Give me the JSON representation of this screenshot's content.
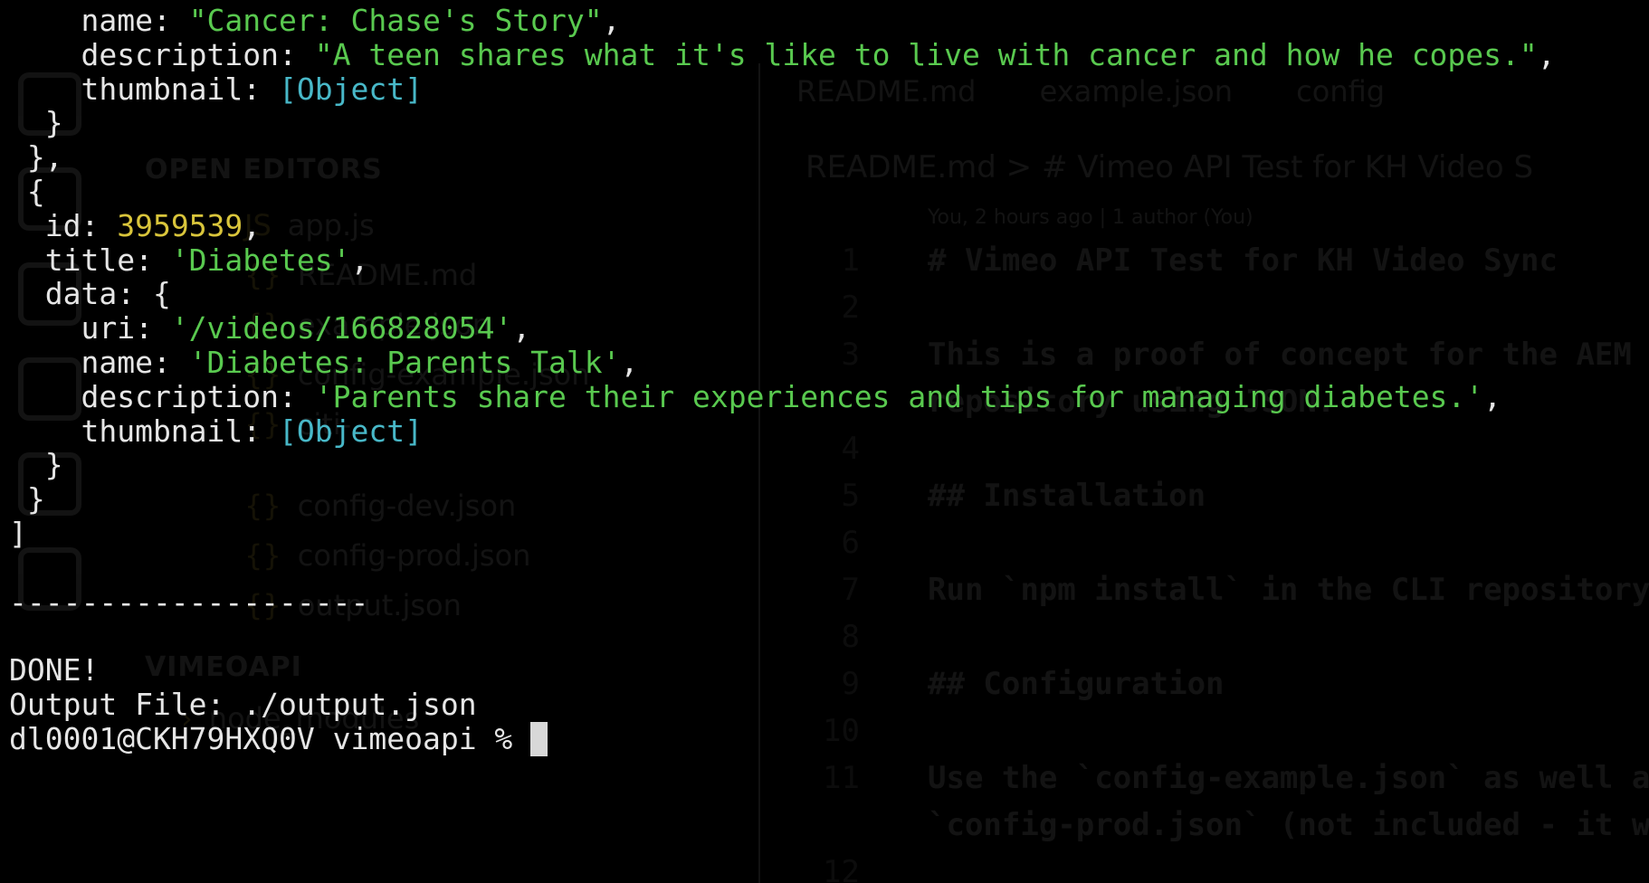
{
  "background_editor": {
    "explorer": {
      "open_editors_header": "OPEN EDITORS",
      "open_editors": [
        "app.js",
        "README.md",
        "example.json",
        "config-example.json",
        "citi-...",
        "config-dev.json",
        "config-prod.json",
        "output.json"
      ],
      "project_header": "VIMEOAPI",
      "project_items": [
        "node_modules"
      ]
    },
    "tabs": [
      "README.md",
      "example.json",
      "config"
    ],
    "breadcrumb": "README.md > # Vimeo API Test for KH Video S",
    "blame": "You, 2 hours ago | 1 author (You)",
    "code_lines": [
      {
        "n": "1",
        "text": "# Vimeo API Test for KH Video Sync"
      },
      {
        "n": "2",
        "text": ""
      },
      {
        "n": "3",
        "text": "This is a proof of concept for the AEM"
      },
      {
        "n": "",
        "text": "repository using JSON."
      },
      {
        "n": "4",
        "text": ""
      },
      {
        "n": "5",
        "text": "## Installation"
      },
      {
        "n": "6",
        "text": ""
      },
      {
        "n": "7",
        "text": "Run `npm install` in the CLI repository"
      },
      {
        "n": "8",
        "text": ""
      },
      {
        "n": "9",
        "text": "## Configuration"
      },
      {
        "n": "10",
        "text": ""
      },
      {
        "n": "11",
        "text": "Use the `config-example.json` as well a"
      },
      {
        "n": "",
        "text": "`config-prod.json` (not included - it w"
      },
      {
        "n": "12",
        "text": ""
      }
    ]
  },
  "terminal": {
    "lines": [
      [
        {
          "t": "    name: "
        },
        {
          "t": "\"Cancer: Chase's Story\"",
          "c": "str"
        },
        {
          "t": ","
        }
      ],
      [
        {
          "t": "    description: "
        },
        {
          "t": "\"A teen shares what it's like to live with cancer and how he copes.\"",
          "c": "str"
        },
        {
          "t": ","
        }
      ],
      [
        {
          "t": "    thumbnail: "
        },
        {
          "t": "[Object]",
          "c": "obj"
        }
      ],
      [
        {
          "t": "  }"
        }
      ],
      [
        {
          "t": " },"
        }
      ],
      [
        {
          "t": " {"
        }
      ],
      [
        {
          "t": "  id: "
        },
        {
          "t": "3959539",
          "c": "num"
        },
        {
          "t": ","
        }
      ],
      [
        {
          "t": "  title: "
        },
        {
          "t": "'Diabetes'",
          "c": "str"
        },
        {
          "t": ","
        }
      ],
      [
        {
          "t": "  data: {"
        }
      ],
      [
        {
          "t": "    uri: "
        },
        {
          "t": "'/videos/166828054'",
          "c": "str"
        },
        {
          "t": ","
        }
      ],
      [
        {
          "t": "    name: "
        },
        {
          "t": "'Diabetes: Parents Talk'",
          "c": "str"
        },
        {
          "t": ","
        }
      ],
      [
        {
          "t": "    description: "
        },
        {
          "t": "'Parents share their experiences and tips for managing diabetes.'",
          "c": "str"
        },
        {
          "t": ","
        }
      ],
      [
        {
          "t": "    thumbnail: "
        },
        {
          "t": "[Object]",
          "c": "obj"
        }
      ],
      [
        {
          "t": "  }"
        }
      ],
      [
        {
          "t": " }"
        }
      ],
      [
        {
          "t": "]"
        }
      ],
      [
        {
          "t": ""
        }
      ],
      [
        {
          "t": "--------------------"
        }
      ],
      [
        {
          "t": ""
        }
      ],
      [
        {
          "t": "DONE!"
        }
      ],
      [
        {
          "t": "Output File: ./output.json"
        }
      ]
    ],
    "prompt": "dl0001@CKH79HXQ0V vimeoapi % "
  },
  "colors": {
    "background": "#000000",
    "text": "#e6e6e6",
    "string": "#59c94f",
    "number": "#d9c53b",
    "object": "#48b8c8"
  }
}
